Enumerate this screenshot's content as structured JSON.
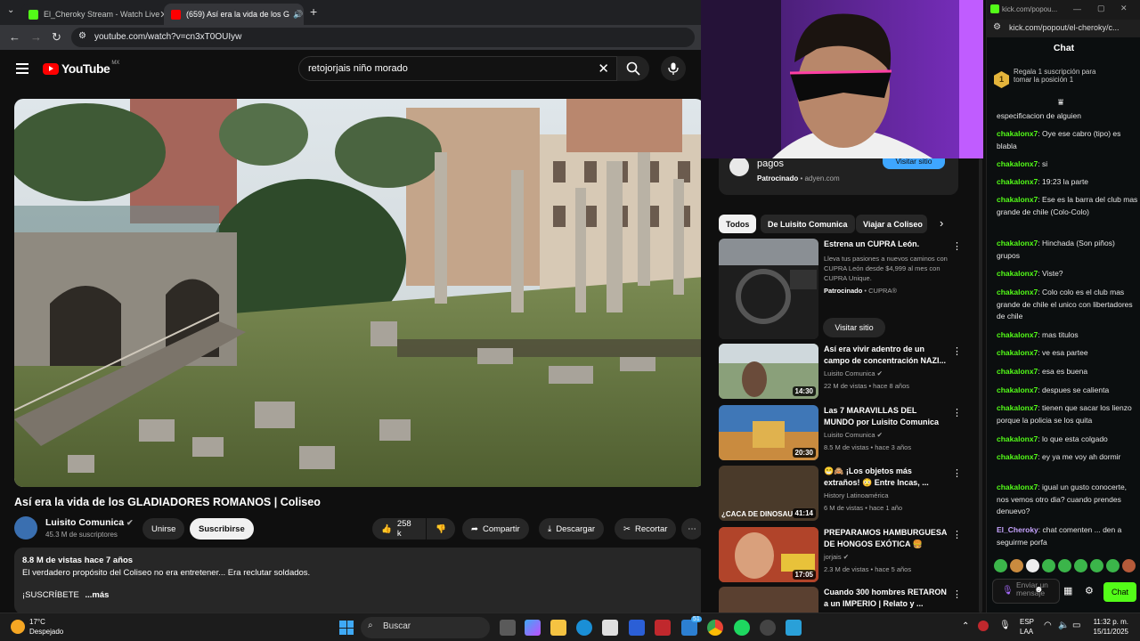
{
  "browser": {
    "tabs": [
      {
        "label": "El_Cheroky Stream - Watch Live",
        "favicon_color": "#53fc18"
      },
      {
        "label": "(659) Así era la vida de los G",
        "favicon_color": "#ff0000"
      }
    ],
    "new_tab": "+",
    "url": "youtube.com/watch?v=cn3xT0OUIyw"
  },
  "youtube": {
    "logo_text": "YouTube",
    "region": "MX",
    "search_value": "retojorjais niño morado",
    "video": {
      "title": "Así era la vida de los GLADIADORES ROMANOS | Coliseo",
      "channel": "Luisito Comunica",
      "subscribers": "45.3 M de suscriptores",
      "join_label": "Unirse",
      "subscribe_label": "Suscribirse",
      "likes": "258 k",
      "share_label": "Compartir",
      "download_label": "Descargar",
      "clip_label": "Recortar",
      "views_date": "8.8 M de vistas  hace 7 años",
      "description": "El verdadero propósito del Coliseo no era entretener... Era reclutar soldados.",
      "desc_more_prefix": "¡SUSCRÍBETE",
      "desc_more": "...más"
    },
    "sidebar": {
      "ad_top": {
        "title": "pagos",
        "sponsored": "Patrocinado",
        "domain": "adyen.com",
        "cta": "Visitar sitio"
      },
      "chips": [
        "Todos",
        "De Luisito Comunica",
        "Viajar a Coliseo"
      ],
      "ad": {
        "title": "Estrena un CUPRA León.",
        "text": "Lleva tus pasiones a nuevos caminos con CUPRA León desde $4,999 al mes con CUPRA Unique.",
        "sponsored": "Patrocinado",
        "brand": "CUPRA®",
        "cta": "Visitar sitio"
      },
      "recommendations": [
        {
          "title": "Así era vivir adentro de un campo de concentración NAZI...",
          "channel": "Luisito Comunica",
          "meta": "22 M de vistas • hace 8 años",
          "duration": "14:30",
          "thumb_color": "#6d7d5a"
        },
        {
          "title": "Las 7 MARAVILLAS DEL MUNDO por Luisito Comunica",
          "channel": "Luisito Comunica",
          "meta": "8.5 M de vistas • hace 3 años",
          "duration": "20:30",
          "thumb_color": "#b27a3a"
        },
        {
          "title": "😁🙈 ¡Los objetos más extraños! 😳 Entre Incas, ...",
          "channel": "History Latinoamérica",
          "meta": "6 M de vistas • hace 1 año",
          "duration": "41:14",
          "thumb_text": "¿CACA DE DINOSAU",
          "thumb_color": "#4a3a2a"
        },
        {
          "title": "PREPARAMOS HAMBURGUESA DE HONGOS EXÓTICA 🍔",
          "channel": "jorjais",
          "meta": "2.3 M de vistas • hace 5 años",
          "duration": "17:05",
          "thumb_color": "#a83a1e"
        },
        {
          "title": "Cuando 300 hombres RETARON a un IMPERIO | Relato y ...",
          "channel": "",
          "meta": "",
          "duration": "",
          "thumb_color": "#5a4030"
        }
      ]
    }
  },
  "kick": {
    "title": "kick.com/popou...",
    "url": "kick.com/popout/el-cheroky/c...",
    "chat_label": "Chat",
    "gift_text": "Regala 1 suscripción para tomar la posición 1",
    "gift_rank": "1",
    "messages": [
      {
        "user": "",
        "text": "especificacion de alguien"
      },
      {
        "user": "chakalonx7",
        "text": "Oye ese cabro (tipo) es blabla"
      },
      {
        "user": "chakalonx7",
        "text": "si"
      },
      {
        "user": "chakalonx7",
        "text": "19:23 la parte"
      },
      {
        "user": "chakalonx7",
        "text": "Ese es la barra del club mas grande de chile (Colo-Colo)"
      },
      {
        "user": "chakalonx7",
        "text": "Hinchada (Son piños) grupos"
      },
      {
        "user": "chakalonx7",
        "text": "Viste?"
      },
      {
        "user": "chakalonx7",
        "text": "Colo colo es el club mas grande de chile el unico con libertadores de chile"
      },
      {
        "user": "chakalonx7",
        "text": "mas titulos"
      },
      {
        "user": "chakalonx7",
        "text": "ve esa partee"
      },
      {
        "user": "chakalonx7",
        "text": "esa es buena"
      },
      {
        "user": "chakalonx7",
        "text": "despues se calienta"
      },
      {
        "user": "chakalonx7",
        "text": "tienen que sacar los lienzo porque la policia se los quita"
      },
      {
        "user": "chakalonx7",
        "text": "lo que esta colgado"
      },
      {
        "user": "chakalonx7",
        "text": "ey ya me voy ah dormir"
      },
      {
        "user": "chakalonx7",
        "text": "igual un gusto conocerte, nos vemos otro dia? cuando prendes denuevo?"
      },
      {
        "user": "El_Cheroky",
        "text": "chat comenten ... den a seguirme porfa"
      }
    ],
    "input_placeholder": "Enviar un mensaje",
    "chat_button": "Chat"
  },
  "taskbar": {
    "weather_temp": "17°C",
    "weather_desc": "Despejado",
    "search_label": "Buscar",
    "lang": "ESP",
    "lang_sub": "LAA",
    "time": "11:32 p. m.",
    "date": "15/11/2025",
    "badge": "51"
  }
}
